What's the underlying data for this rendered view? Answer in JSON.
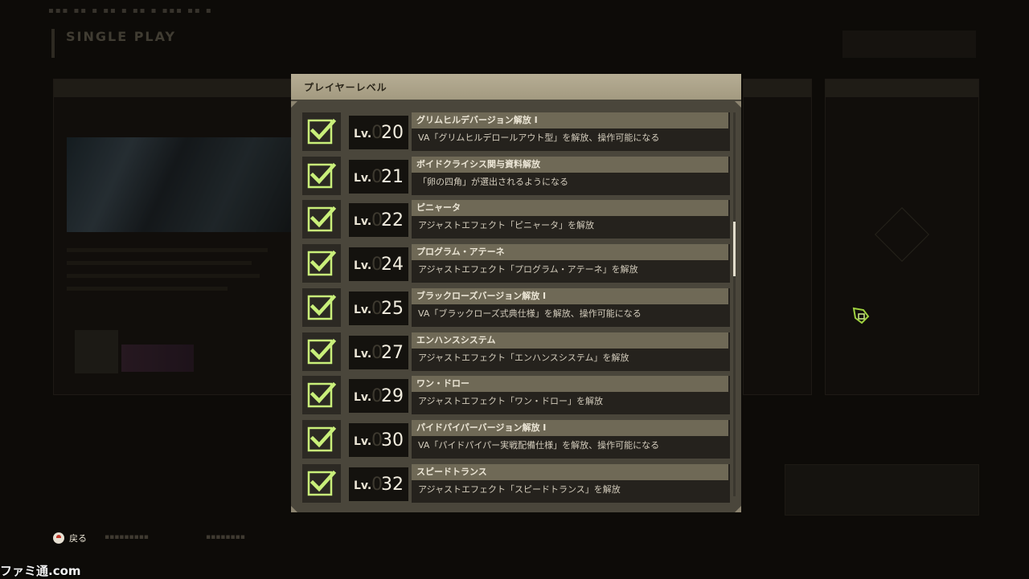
{
  "modal": {
    "title": "プレイヤーレベル",
    "rows": [
      {
        "lv_label": "Lv.",
        "lv_pad": "0",
        "lv_num": "20",
        "name": "グリムヒルデバージョン解放 I",
        "desc": "VA「グリムヒルデロールアウト型」を解放、操作可能になる",
        "checked": true
      },
      {
        "lv_label": "Lv.",
        "lv_pad": "0",
        "lv_num": "21",
        "name": "ボイドクライシス関与資料解放",
        "desc": "「卵の四角」が選出されるようになる",
        "checked": true
      },
      {
        "lv_label": "Lv.",
        "lv_pad": "0",
        "lv_num": "22",
        "name": "ピニャータ",
        "desc": "アジャストエフェクト「ピニャータ」を解放",
        "checked": true
      },
      {
        "lv_label": "Lv.",
        "lv_pad": "0",
        "lv_num": "24",
        "name": "プログラム・アテーネ",
        "desc": "アジャストエフェクト「プログラム・アテーネ」を解放",
        "checked": true
      },
      {
        "lv_label": "Lv.",
        "lv_pad": "0",
        "lv_num": "25",
        "name": "ブラックローズバージョン解放 I",
        "desc": "VA「ブラックローズ式典仕様」を解放、操作可能になる",
        "checked": true
      },
      {
        "lv_label": "Lv.",
        "lv_pad": "0",
        "lv_num": "27",
        "name": "エンハンスシステム",
        "desc": "アジャストエフェクト「エンハンスシステム」を解放",
        "checked": true
      },
      {
        "lv_label": "Lv.",
        "lv_pad": "0",
        "lv_num": "29",
        "name": "ワン・ドロー",
        "desc": "アジャストエフェクト「ワン・ドロー」を解放",
        "checked": true
      },
      {
        "lv_label": "Lv.",
        "lv_pad": "0",
        "lv_num": "30",
        "name": "パイドパイパーバージョン解放 I",
        "desc": "VA「パイドパイパー実戦配備仕様」を解放、操作可能になる",
        "checked": true
      },
      {
        "lv_label": "Lv.",
        "lv_pad": "0",
        "lv_num": "32",
        "name": "スピードトランス",
        "desc": "アジャストエフェクト「スピードトランス」を解放",
        "checked": true
      }
    ]
  },
  "background": {
    "title": "SINGLE PLAY"
  },
  "footer": {
    "back_label": "戻る"
  },
  "watermark": "ファミ通.com",
  "colors": {
    "check": "#c9ef7a",
    "header": "#b6ad94",
    "accent_cursor": "#9fd13f"
  }
}
